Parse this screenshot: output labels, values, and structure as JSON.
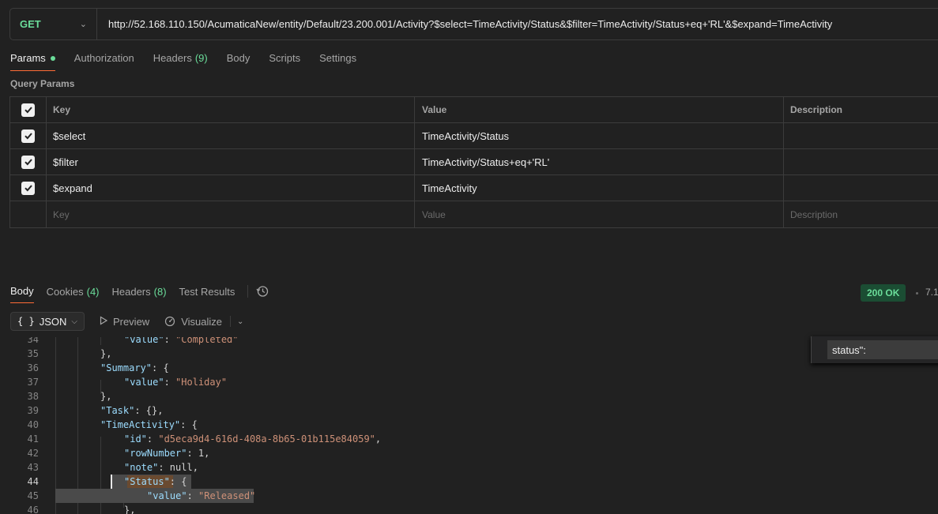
{
  "request": {
    "method": "GET",
    "url": "http://52.168.110.150/AcumaticaNew/entity/Default/23.200.001/Activity?$select=TimeActivity/Status&$filter=TimeActivity/Status+eq+'RL'&$expand=TimeActivity"
  },
  "request_tabs": [
    {
      "label": "Params",
      "badge": ""
    },
    {
      "label": "Authorization",
      "badge": ""
    },
    {
      "label": "Headers",
      "badge": "(9)"
    },
    {
      "label": "Body",
      "badge": ""
    },
    {
      "label": "Scripts",
      "badge": ""
    },
    {
      "label": "Settings",
      "badge": ""
    }
  ],
  "query_params": {
    "title": "Query Params",
    "headers": {
      "key": "Key",
      "value": "Value",
      "description": "Description"
    },
    "rows": [
      {
        "key": "$select",
        "value": "TimeActivity/Status",
        "description": ""
      },
      {
        "key": "$filter",
        "value": "TimeActivity/Status+eq+'RL'",
        "description": ""
      },
      {
        "key": "$expand",
        "value": "TimeActivity",
        "description": ""
      }
    ],
    "placeholder": {
      "key": "Key",
      "value": "Value",
      "description": "Description"
    }
  },
  "response_tabs": [
    {
      "label": "Body",
      "badge": ""
    },
    {
      "label": "Cookies",
      "badge": "(4)"
    },
    {
      "label": "Headers",
      "badge": "(8)"
    },
    {
      "label": "Test Results",
      "badge": ""
    }
  ],
  "status": {
    "code": "200 OK",
    "time": "7.1"
  },
  "toolbar": {
    "format": "JSON",
    "preview": "Preview",
    "visualize": "Visualize"
  },
  "find": {
    "query": "status\":"
  },
  "code_lines": [
    {
      "n": "34",
      "text": "\"value\": \"Completed\""
    },
    {
      "n": "35",
      "text": "},"
    },
    {
      "n": "36",
      "text": "\"Summary\": {"
    },
    {
      "n": "37",
      "text": "\"value\": \"Holiday\""
    },
    {
      "n": "38",
      "text": "},"
    },
    {
      "n": "39",
      "text": "\"Task\": {},"
    },
    {
      "n": "40",
      "text": "\"TimeActivity\": {"
    },
    {
      "n": "41",
      "text": "\"id\": \"d5eca9d4-616d-408a-8b65-01b115e84059\","
    },
    {
      "n": "42",
      "text": "\"rowNumber\": 1,"
    },
    {
      "n": "43",
      "text": "\"note\": null,"
    },
    {
      "n": "44",
      "text": "\"Status\": {"
    },
    {
      "n": "45",
      "text": "\"value\": \"Released\""
    },
    {
      "n": "46",
      "text": "},"
    }
  ],
  "colors": {
    "accent": "#ff6c37",
    "success": "#6bdd9a",
    "string": "#ce9178",
    "key": "#9cdcfe"
  }
}
